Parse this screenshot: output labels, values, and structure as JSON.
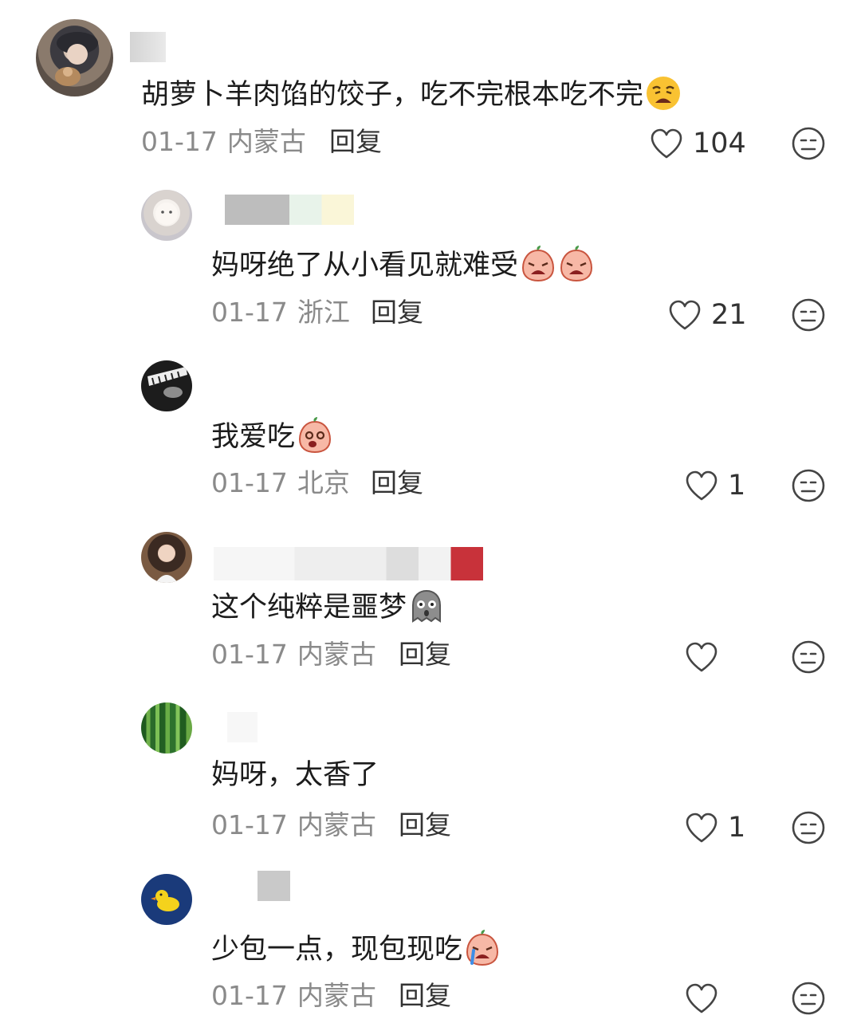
{
  "comments": [
    {
      "text": "胡萝卜羊肉馅的饺子，吃不完根本吃不完",
      "emoji": "weary-face-icon",
      "date": "01-17",
      "region": "内蒙古",
      "reply_label": "回复",
      "likes": "104"
    },
    {
      "text": "妈呀绝了从小看见就难受",
      "emoji": "crying-peach-icon",
      "date": "01-17",
      "region": "浙江",
      "reply_label": "回复",
      "likes": "21"
    },
    {
      "text": "我爱吃",
      "emoji": "surprised-peach-icon",
      "date": "01-17",
      "region": "北京",
      "reply_label": "回复",
      "likes": "1"
    },
    {
      "text": "这个纯粹是噩梦",
      "emoji": "scared-ghost-icon",
      "date": "01-17",
      "region": "内蒙古",
      "reply_label": "回复",
      "likes": ""
    },
    {
      "text": "妈呀，太香了",
      "date": "01-17",
      "region": "内蒙古",
      "reply_label": "回复",
      "likes": "1"
    },
    {
      "text": "少包一点，现包现吃",
      "emoji": "crying-peach-icon",
      "date": "01-17",
      "region": "内蒙古",
      "reply_label": "回复",
      "likes": ""
    }
  ]
}
